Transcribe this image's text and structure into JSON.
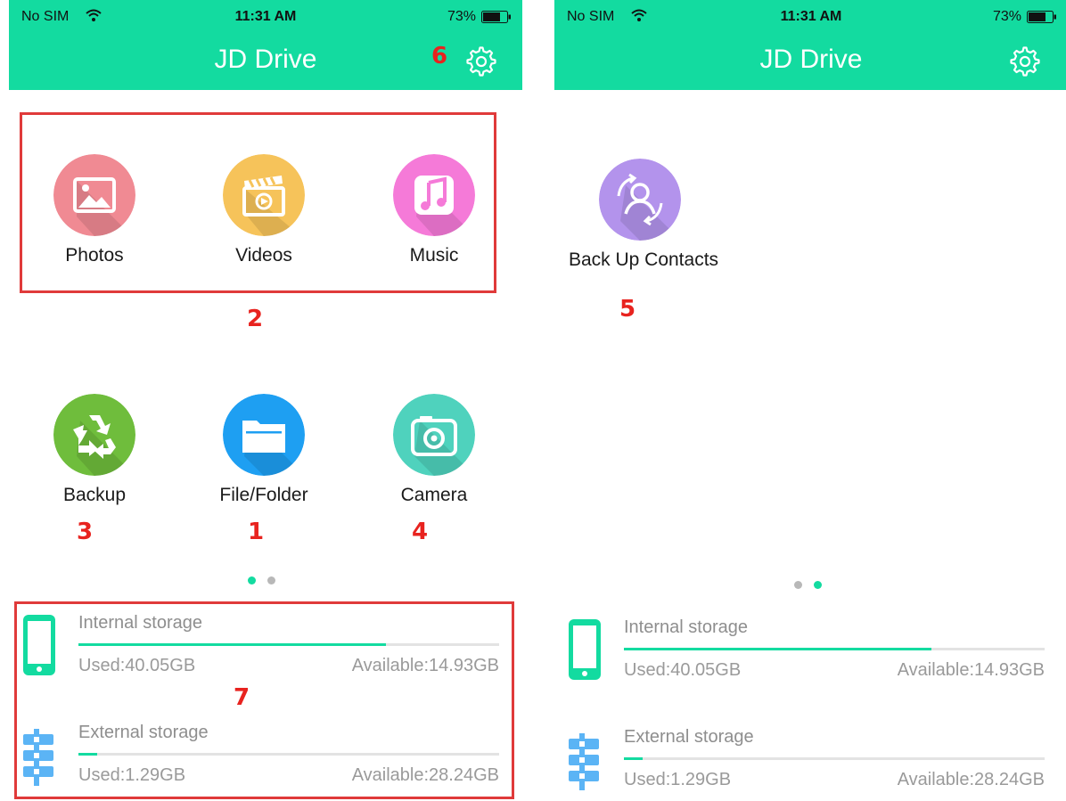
{
  "status_bar": {
    "carrier": "No SIM",
    "time": "11:31 AM",
    "battery": "73%",
    "battery_level": 0.73
  },
  "app": {
    "title": "JD Drive"
  },
  "left_screen": {
    "row1": [
      {
        "label": "Photos",
        "icon": "photos-icon",
        "color": "#f08a93"
      },
      {
        "label": "Videos",
        "icon": "videos-icon",
        "color": "#f6c35a"
      },
      {
        "label": "Music",
        "icon": "music-icon",
        "color": "#f57ad8"
      }
    ],
    "row2": [
      {
        "label": "Backup",
        "icon": "recycle-icon",
        "color": "#6fbd3c"
      },
      {
        "label": "File/Folder",
        "icon": "folder-icon",
        "color": "#1e9ff2"
      },
      {
        "label": "Camera",
        "icon": "camera-icon",
        "color": "#4fd2bd"
      }
    ],
    "page_indicator": {
      "active_page": 1,
      "pages": 2
    }
  },
  "right_screen": {
    "tiles": [
      {
        "label": "Back Up Contacts",
        "icon": "contacts-backup-icon",
        "color": "#b393ec"
      }
    ],
    "page_indicator": {
      "active_page": 2,
      "pages": 2
    }
  },
  "storage": {
    "internal": {
      "name": "Internal storage",
      "used": "Used:40.05GB",
      "available": "Available:14.93GB",
      "fraction_used": 0.73
    },
    "external": {
      "name": "External storage",
      "used": "Used:1.29GB",
      "available": "Available:28.24GB",
      "fraction_used": 0.045
    }
  },
  "callouts": {
    "file_folder": "1",
    "media_group": "2",
    "backup": "3",
    "camera": "4",
    "contacts": "5",
    "settings": "6",
    "storage": "7"
  },
  "colors": {
    "accent": "#13dba0",
    "callout": "#e8231f",
    "dot_inactive": "#b8b8b8"
  }
}
